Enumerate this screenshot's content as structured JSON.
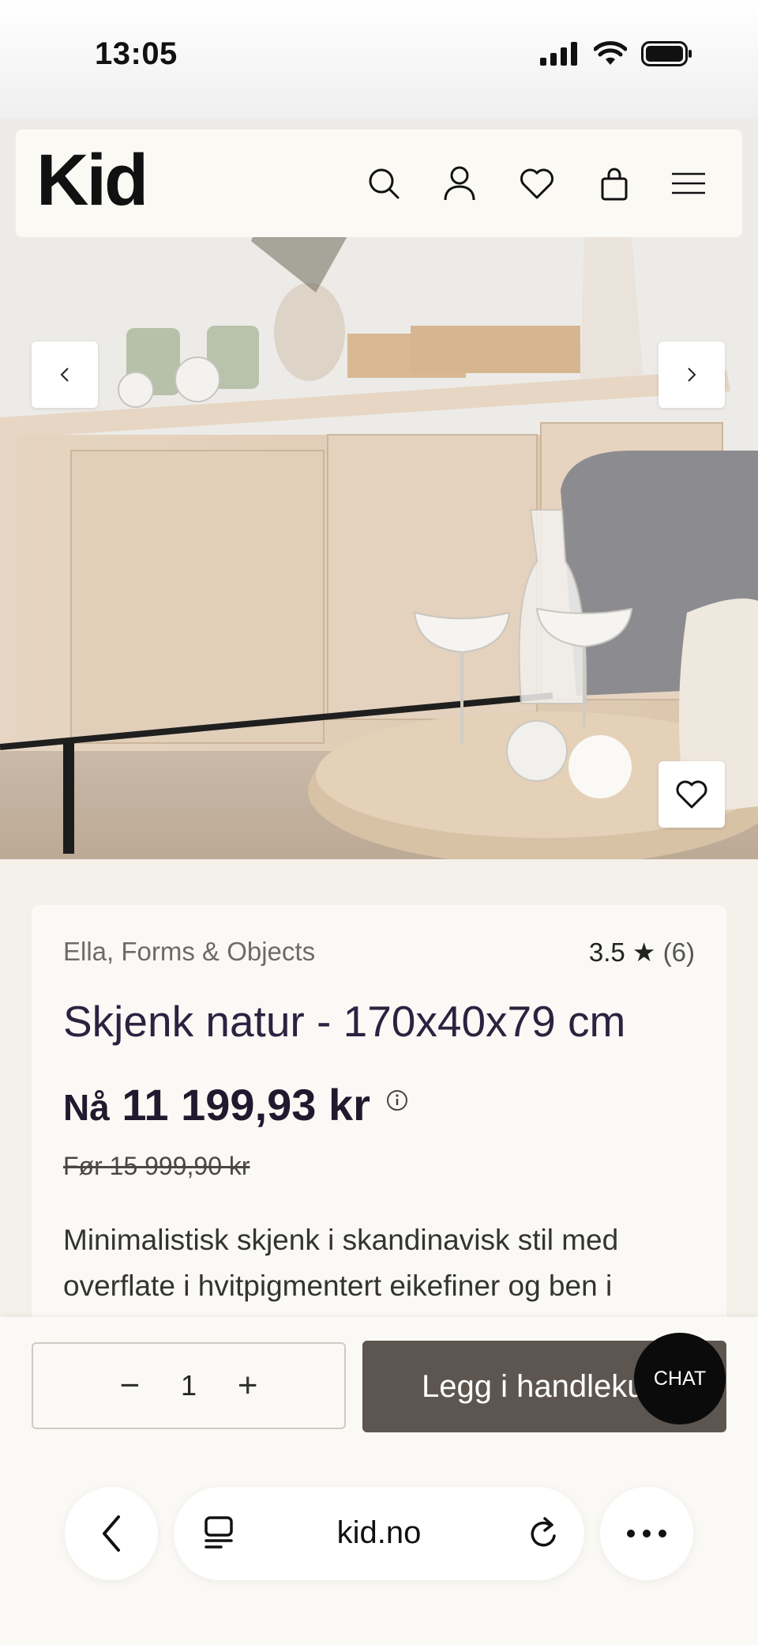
{
  "status_bar": {
    "time": "13:05"
  },
  "header": {
    "logo": "Kid",
    "icons": [
      "search-icon",
      "account-icon",
      "heart-icon",
      "bag-icon",
      "menu-icon"
    ]
  },
  "gallery": {
    "prev_icon": "chevron-left-icon",
    "next_icon": "chevron-right-icon",
    "favorite_icon": "heart-icon"
  },
  "product": {
    "brand": "Ella, Forms & Objects",
    "rating": "3.5",
    "rating_star": "★",
    "review_count": "(6)",
    "title": "Skjenk natur - 170x40x79 cm",
    "price_prefix": "Nå",
    "price": "11 199,93 kr",
    "old_price": "Før 15 999,90 kr",
    "description": "Minimalistisk skjenk i skandinavisk stil med overflate i hvitpigmentert eikefiner og ben i"
  },
  "cart": {
    "quantity": "1",
    "minus": "−",
    "plus": "+",
    "add_label": "Legg i handlekurv",
    "chat_label": "CHAT"
  },
  "browser": {
    "url": "kid.no"
  },
  "colors": {
    "page_bg": "#f4f0ea",
    "card_bg": "#fbf9f5",
    "add_button": "#5d5650",
    "title_text": "#2a2340",
    "chat_bg": "#0b0b0b"
  }
}
